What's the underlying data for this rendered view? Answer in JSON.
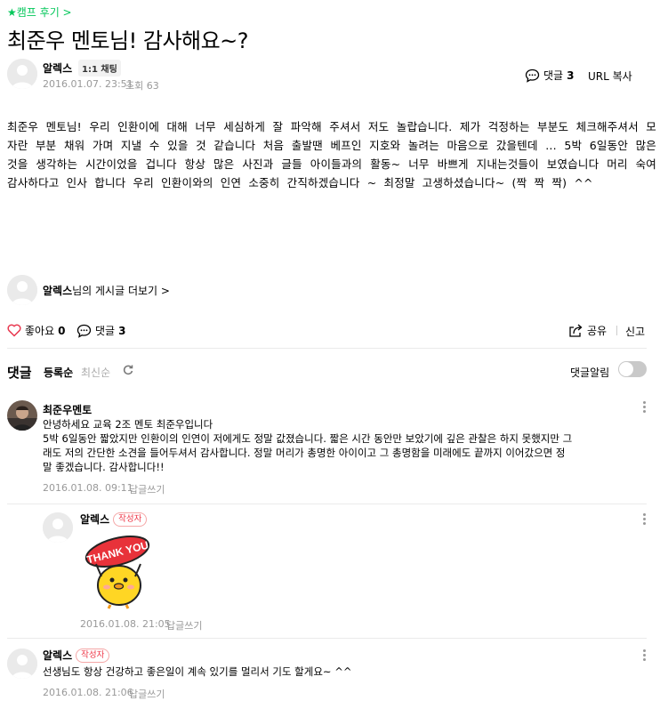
{
  "category": "★캠프 후기 >",
  "post": {
    "title": "최준우 멘토님! 감사해요~?",
    "author": "알렉스",
    "chat_badge": "1:1 채팅",
    "date": "2016.01.07. 23:51",
    "views": "조회 63",
    "comment_count_label": "댓글",
    "comment_count": "3",
    "url_copy": "URL 복사",
    "body": "최준우 멘토님!  우리 인환이에 대해 너무 세심하게 잘 파악해 주셔서 저도 놀랍습니다. 제가 걱정하는 부분도 체크해주셔서 모자란 부분 채워 가며 지낼 수 있을 것 같습니다 처음 출발땐 베프인 지호와 놀려는 마음으로 갔을텐데 ... 5박 6일동안 많은것을 생각하는 시간이었을 겁니다  항상 많은 사진과 글들 아이들과의 활동~  너무 바쁘게 지내는것들이 보였습니다 머리 숙여 감사하다고 인사 합니다 우리 인환이와의 인연 소중히 간직하겠습니다  ~ 최정말 고생하셨습니다~ (짝 짝 짝)  ^^"
  },
  "author_more": {
    "name": "알렉스",
    "suffix": "님의 게시글 더보기 >"
  },
  "actions": {
    "like_label": "좋아요",
    "like_count": "0",
    "comment_label": "댓글",
    "comment_count": "3",
    "share": "공유",
    "report": "신고"
  },
  "comments_header": {
    "title": "댓글",
    "sort_registered": "등록순",
    "sort_latest": "최신순",
    "notify": "댓글알림"
  },
  "comments": [
    {
      "name": "최준우멘토",
      "text_lines": [
        "안녕하세요 교육 2조 멘토 최준우입니다",
        "5박 6일동안 짧았지만 인환이의 인연이 저에게도 정말 값졌습니다. 짧은 시간 동안만 보았기에 깊은 관찰은 하지 못했지만 그",
        "래도 저의 간단한 소견을 들어두셔서 감사합니다. 정말 머리가 총명한 아이이고 그 총명함을 미래에도 끝까지 이어갔으면 정",
        "말 좋겠습니다. 감사합니다!!"
      ],
      "date": "2016.01.08. 09:11",
      "reply": "답글쓰기"
    },
    {
      "name": "알렉스",
      "writer_badge": "작성자",
      "sticker_text": "THANK YOU",
      "date": "2016.01.08. 21:05",
      "reply": "답글쓰기"
    },
    {
      "name": "알렉스",
      "writer_badge": "작성자",
      "text": "선생님도 항상 건강하고 좋은일이 계속 있기를 멀리서 기도 할게요~ ^^",
      "date": "2016.01.08. 21:06",
      "reply": "답글쓰기"
    }
  ],
  "colors": {
    "accent_green": "#03c75a",
    "heart_red": "#e8384f",
    "writer_red": "#e33344"
  },
  "icons": [
    "heart-icon",
    "comment-icon",
    "share-icon",
    "refresh-icon",
    "kebab-icon",
    "default-avatar-icon"
  ]
}
